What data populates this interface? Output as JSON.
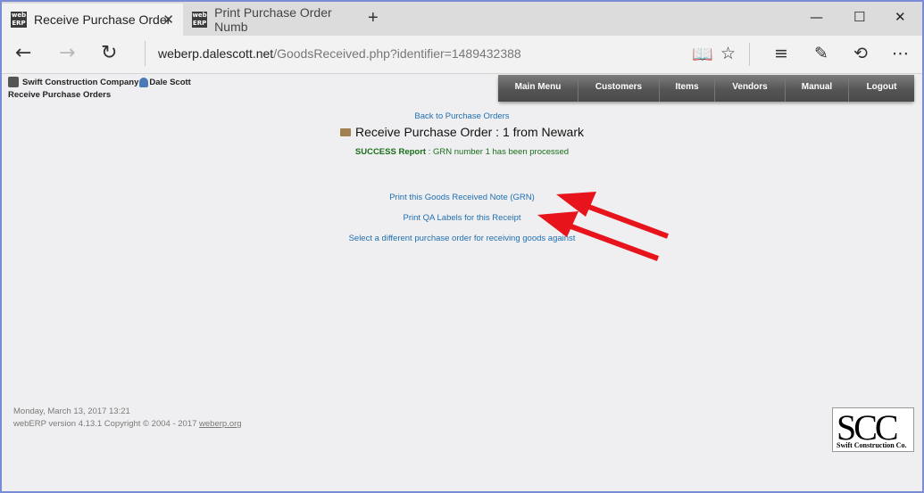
{
  "browser": {
    "tabs": [
      {
        "title": "Receive Purchase Order",
        "active": true
      },
      {
        "title": "Print Purchase Order Numb",
        "active": false
      }
    ],
    "tab_icon_text": "web ERP",
    "url_host": "weberp.dalescott.net",
    "url_path": "/GoodsReceived.php?identifier=1489432388"
  },
  "header": {
    "company": "Swift Construction Company",
    "user": "Dale Scott",
    "breadcrumb": "Receive Purchase Orders"
  },
  "menu": [
    "Main Menu",
    "Customers",
    "Items",
    "Vendors",
    "Manual",
    "Logout"
  ],
  "content": {
    "back_link": "Back to Purchase Orders",
    "title": "Receive Purchase Order : 1 from Newark",
    "success_label": "SUCCESS Report",
    "success_text": " : GRN number 1 has been processed",
    "links": [
      "Print this Goods Received Note (GRN)",
      "Print QA Labels for this Receipt",
      "Select a different purchase order for receiving goods against"
    ]
  },
  "footer": {
    "datetime": "Monday, March 13, 2017 13:21",
    "copyright": "webERP version 4.13.1 Copyright © 2004 - 2017 ",
    "copyright_link": "weberp.org"
  },
  "logo": {
    "big": "SCC",
    "small": "Swift Construction Co."
  },
  "colors": {
    "arrow": "#e8141b",
    "link": "#1f6fb0",
    "success": "#1a6e1a"
  }
}
